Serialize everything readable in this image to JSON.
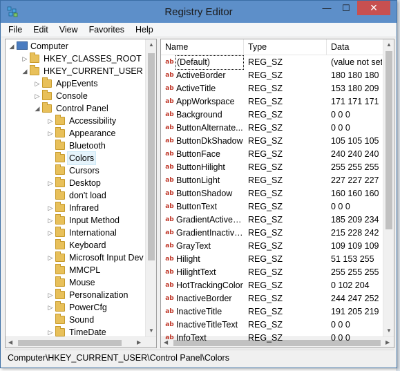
{
  "window": {
    "title": "Registry Editor"
  },
  "menubar": {
    "items": [
      "File",
      "Edit",
      "View",
      "Favorites",
      "Help"
    ]
  },
  "tree": {
    "rows": [
      {
        "label": "Computer",
        "level": 0,
        "expanded": true,
        "icon": "computer-icon"
      },
      {
        "label": "HKEY_CLASSES_ROOT",
        "level": 1,
        "expanded": false
      },
      {
        "label": "HKEY_CURRENT_USER",
        "level": 1,
        "expanded": true
      },
      {
        "label": "AppEvents",
        "level": 2,
        "expanded": false
      },
      {
        "label": "Console",
        "level": 2,
        "expanded": false
      },
      {
        "label": "Control Panel",
        "level": 2,
        "expanded": true
      },
      {
        "label": "Accessibility",
        "level": 3,
        "expanded": false
      },
      {
        "label": "Appearance",
        "level": 3,
        "expanded": false
      },
      {
        "label": "Bluetooth",
        "level": 3,
        "expanded": null
      },
      {
        "label": "Colors",
        "level": 3,
        "expanded": null,
        "selected": true
      },
      {
        "label": "Cursors",
        "level": 3,
        "expanded": null
      },
      {
        "label": "Desktop",
        "level": 3,
        "expanded": false
      },
      {
        "label": "don't load",
        "level": 3,
        "expanded": null
      },
      {
        "label": "Infrared",
        "level": 3,
        "expanded": false
      },
      {
        "label": "Input Method",
        "level": 3,
        "expanded": false
      },
      {
        "label": "International",
        "level": 3,
        "expanded": false
      },
      {
        "label": "Keyboard",
        "level": 3,
        "expanded": null
      },
      {
        "label": "Microsoft Input Dev",
        "level": 3,
        "expanded": false
      },
      {
        "label": "MMCPL",
        "level": 3,
        "expanded": null
      },
      {
        "label": "Mouse",
        "level": 3,
        "expanded": null
      },
      {
        "label": "Personalization",
        "level": 3,
        "expanded": false
      },
      {
        "label": "PowerCfg",
        "level": 3,
        "expanded": false
      },
      {
        "label": "Sound",
        "level": 3,
        "expanded": null
      },
      {
        "label": "TimeDate",
        "level": 3,
        "expanded": false
      }
    ]
  },
  "list": {
    "headers": {
      "name": "Name",
      "type": "Type",
      "data": "Data"
    },
    "rows": [
      {
        "name": "(Default)",
        "type": "REG_SZ",
        "data": "(value not set)"
      },
      {
        "name": "ActiveBorder",
        "type": "REG_SZ",
        "data": "180 180 180"
      },
      {
        "name": "ActiveTitle",
        "type": "REG_SZ",
        "data": "153 180 209"
      },
      {
        "name": "AppWorkspace",
        "type": "REG_SZ",
        "data": "171 171 171"
      },
      {
        "name": "Background",
        "type": "REG_SZ",
        "data": "0 0 0"
      },
      {
        "name": "ButtonAlternate...",
        "type": "REG_SZ",
        "data": "0 0 0"
      },
      {
        "name": "ButtonDkShadow",
        "type": "REG_SZ",
        "data": "105 105 105"
      },
      {
        "name": "ButtonFace",
        "type": "REG_SZ",
        "data": "240 240 240"
      },
      {
        "name": "ButtonHilight",
        "type": "REG_SZ",
        "data": "255 255 255"
      },
      {
        "name": "ButtonLight",
        "type": "REG_SZ",
        "data": "227 227 227"
      },
      {
        "name": "ButtonShadow",
        "type": "REG_SZ",
        "data": "160 160 160"
      },
      {
        "name": "ButtonText",
        "type": "REG_SZ",
        "data": "0 0 0"
      },
      {
        "name": "GradientActiveT...",
        "type": "REG_SZ",
        "data": "185 209 234"
      },
      {
        "name": "GradientInactive...",
        "type": "REG_SZ",
        "data": "215 228 242"
      },
      {
        "name": "GrayText",
        "type": "REG_SZ",
        "data": "109 109 109"
      },
      {
        "name": "Hilight",
        "type": "REG_SZ",
        "data": "51 153 255"
      },
      {
        "name": "HilightText",
        "type": "REG_SZ",
        "data": "255 255 255"
      },
      {
        "name": "HotTrackingColor",
        "type": "REG_SZ",
        "data": "0 102 204"
      },
      {
        "name": "InactiveBorder",
        "type": "REG_SZ",
        "data": "244 247 252"
      },
      {
        "name": "InactiveTitle",
        "type": "REG_SZ",
        "data": "191 205 219"
      },
      {
        "name": "InactiveTitleText",
        "type": "REG_SZ",
        "data": "0 0 0"
      },
      {
        "name": "InfoText",
        "type": "REG_SZ",
        "data": "0 0 0"
      }
    ]
  },
  "statusbar": {
    "path": "Computer\\HKEY_CURRENT_USER\\Control Panel\\Colors"
  },
  "colors": {
    "titlebar": "#5d8fc9",
    "close": "#c75050",
    "value_icon": "#c0392b",
    "folder": "#e8c05a"
  },
  "icons": {
    "app": "registry-editor-icon",
    "folder": "folder-icon",
    "value": "string-value-icon"
  }
}
